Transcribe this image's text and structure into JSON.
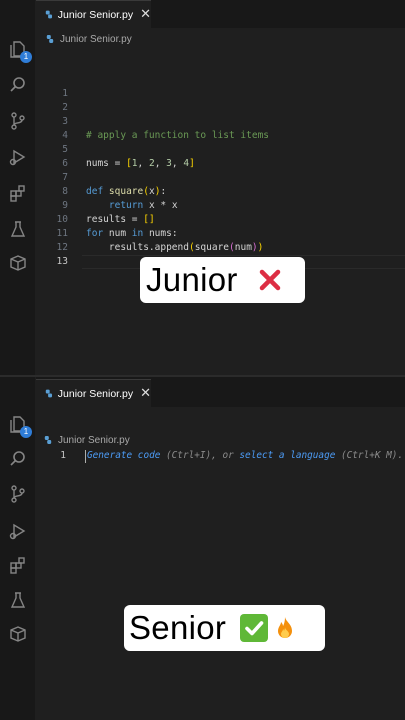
{
  "colors": {
    "keyword": "#569cd6",
    "function": "#dcdcaa",
    "variable": "#9cdcfe",
    "comment": "#6a9955",
    "number": "#b5cea8",
    "bracket_gold": "#ffd700",
    "bracket_purple": "#da70d6",
    "hint_link": "#4c9bf5",
    "badge": "#2f7dd8"
  },
  "activity_bar": {
    "icons": [
      "explorer-icon",
      "search-icon",
      "source-control-icon",
      "run-debug-icon",
      "extensions-icon",
      "testing-icon",
      "remote-explorer-icon"
    ],
    "explorer_badge": "1"
  },
  "junior": {
    "tab": {
      "file_icon": "python-icon",
      "label": "Junior Senior.py",
      "close": "✕"
    },
    "breadcrumb": {
      "icon": "python-icon",
      "label": "Junior Senior.py"
    },
    "lines": [
      {
        "n": "1",
        "tokens": []
      },
      {
        "n": "2",
        "tokens": []
      },
      {
        "n": "3",
        "tokens": []
      },
      {
        "n": "4",
        "tokens": [
          {
            "t": "# apply a function to list items",
            "c": "comment"
          }
        ]
      },
      {
        "n": "5",
        "tokens": []
      },
      {
        "n": "6",
        "tokens": [
          {
            "t": "nums",
            "c": "plain"
          },
          {
            "t": " = ",
            "c": "plain"
          },
          {
            "t": "[",
            "c": "bracket_gold"
          },
          {
            "t": "1",
            "c": "number"
          },
          {
            "t": ", ",
            "c": "plain"
          },
          {
            "t": "2",
            "c": "number"
          },
          {
            "t": ", ",
            "c": "plain"
          },
          {
            "t": "3",
            "c": "number"
          },
          {
            "t": ", ",
            "c": "plain"
          },
          {
            "t": "4",
            "c": "number"
          },
          {
            "t": "]",
            "c": "bracket_gold"
          }
        ]
      },
      {
        "n": "7",
        "tokens": []
      },
      {
        "n": "8",
        "tokens": [
          {
            "t": "def",
            "c": "keyword"
          },
          {
            "t": " ",
            "c": "plain"
          },
          {
            "t": "square",
            "c": "function"
          },
          {
            "t": "(",
            "c": "bracket_gold"
          },
          {
            "t": "x",
            "c": "plain"
          },
          {
            "t": ")",
            "c": "bracket_gold"
          },
          {
            "t": ":",
            "c": "plain"
          }
        ]
      },
      {
        "n": "9",
        "tokens": [
          {
            "t": "    ",
            "c": "plain"
          },
          {
            "t": "return",
            "c": "keyword"
          },
          {
            "t": " x * x",
            "c": "plain"
          }
        ]
      },
      {
        "n": "10",
        "tokens": [
          {
            "t": "results",
            "c": "plain"
          },
          {
            "t": " = ",
            "c": "plain"
          },
          {
            "t": "[]",
            "c": "bracket_gold"
          }
        ]
      },
      {
        "n": "11",
        "tokens": [
          {
            "t": "for",
            "c": "keyword"
          },
          {
            "t": " num ",
            "c": "plain"
          },
          {
            "t": "in",
            "c": "keyword"
          },
          {
            "t": " nums:",
            "c": "plain"
          }
        ]
      },
      {
        "n": "12",
        "tokens": [
          {
            "t": "    results.append",
            "c": "plain"
          },
          {
            "t": "(",
            "c": "bracket_gold"
          },
          {
            "t": "square",
            "c": "plain"
          },
          {
            "t": "(",
            "c": "bracket_purple"
          },
          {
            "t": "num",
            "c": "plain"
          },
          {
            "t": ")",
            "c": "bracket_purple"
          },
          {
            "t": ")",
            "c": "bracket_gold"
          }
        ]
      },
      {
        "n": "13",
        "tokens": [],
        "active": true
      }
    ],
    "caption": {
      "text": "Junior",
      "emoji": "cross-mark-icon"
    }
  },
  "senior": {
    "tab": {
      "file_icon": "python-icon",
      "label": "Junior Senior.py",
      "close": "✕"
    },
    "breadcrumb": {
      "icon": "python-icon",
      "label": "Junior Senior.py"
    },
    "line_number": "1",
    "hint": {
      "link1": "Generate code",
      "mid": " (Ctrl+I), or ",
      "link2": "select a language",
      "end": " (Ctrl+K M)."
    },
    "caption": {
      "text": "Senior",
      "emojis": [
        "check-mark-icon",
        "fire-icon"
      ]
    }
  }
}
